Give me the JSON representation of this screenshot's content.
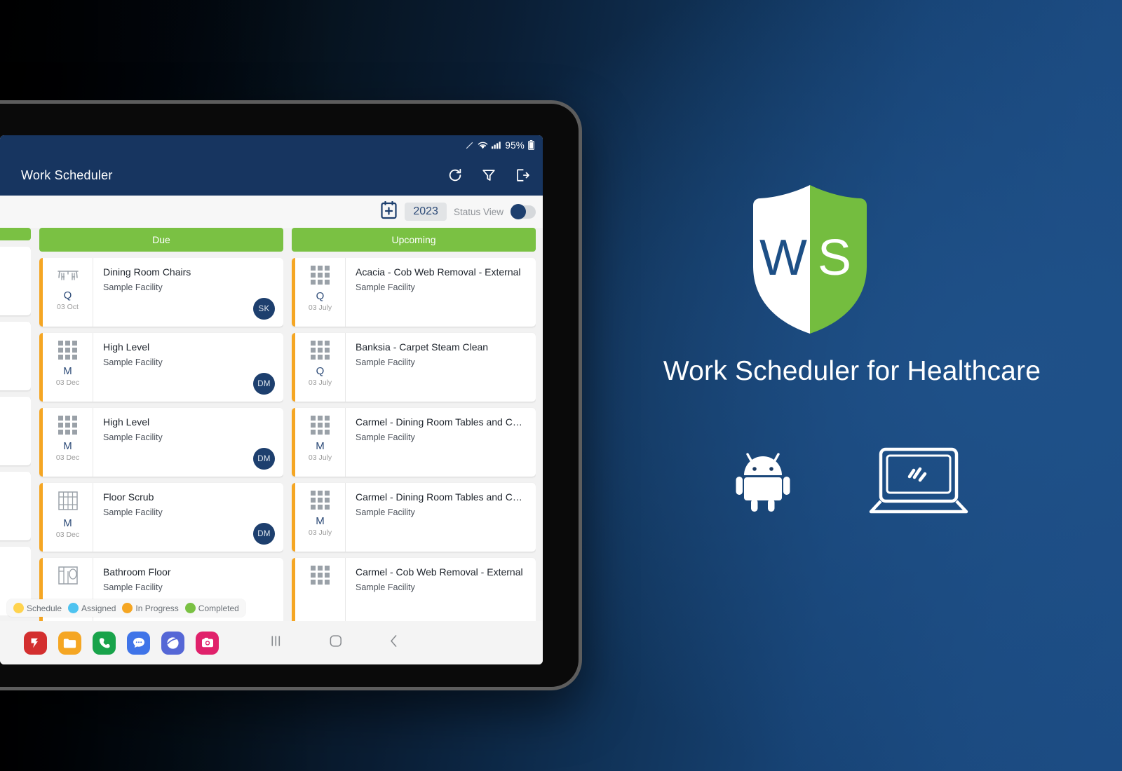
{
  "brand": {
    "title": "Work Scheduler for Healthcare",
    "logo_letters": {
      "left": "W",
      "right": "S"
    },
    "colors": {
      "navy": "#173560",
      "green": "#7ac143",
      "accent_orange": "#f5a623",
      "background_navy": "#1b4a80"
    }
  },
  "platforms": [
    {
      "name": "android-icon",
      "label": "Android"
    },
    {
      "name": "laptop-icon",
      "label": "Web / Desktop"
    }
  ],
  "device": {
    "status_bar": {
      "battery_percent": "95%",
      "icons": [
        "pen-icon",
        "wifi-icon",
        "signal-icon",
        "battery-icon"
      ]
    },
    "app_bar": {
      "title": "Work Scheduler",
      "actions": [
        {
          "name": "refresh-icon",
          "label": "Refresh"
        },
        {
          "name": "filter-icon",
          "label": "Filter"
        },
        {
          "name": "logout-icon",
          "label": "Logout"
        }
      ]
    },
    "sub_bar": {
      "add_date_icon": "calendar-plus-icon",
      "year": "2023",
      "status_view_label": "Status View",
      "status_view_on": true
    },
    "legend": [
      {
        "label": "Schedule",
        "color": "#ffd34e"
      },
      {
        "label": "Assigned",
        "color": "#4ec3f0"
      },
      {
        "label": "In Progress",
        "color": "#f5a623"
      },
      {
        "label": "Completed",
        "color": "#7ac143"
      }
    ],
    "nav_buttons": [
      {
        "name": "recents-button",
        "glyph": "|||"
      },
      {
        "name": "home-button",
        "glyph": "○"
      },
      {
        "name": "back-button",
        "glyph": "‹"
      }
    ],
    "dock_apps": [
      {
        "name": "app-icon-1",
        "color": "#d32f2f"
      },
      {
        "name": "app-icon-2",
        "color": "#f5a623"
      },
      {
        "name": "app-icon-3",
        "color": "#18a34a"
      },
      {
        "name": "app-icon-4",
        "color": "#3f74e8"
      },
      {
        "name": "app-icon-5",
        "color": "#5567d6"
      },
      {
        "name": "app-icon-6",
        "color": "#e0216b"
      }
    ]
  },
  "board": {
    "columns": [
      {
        "id": "partial",
        "header": "",
        "cards": [
          {
            "title": "",
            "facility": "",
            "frequency": "",
            "date": "",
            "initials": "",
            "icon": "blank"
          },
          {
            "title": "",
            "facility": "",
            "frequency": "",
            "date": "",
            "initials": "",
            "icon": "blank"
          },
          {
            "title": "",
            "facility": "",
            "frequency": "",
            "date": "",
            "initials": "",
            "icon": "blank"
          },
          {
            "title": "",
            "facility": "",
            "frequency": "",
            "date": "",
            "initials": "",
            "icon": "blank"
          },
          {
            "title": "",
            "facility": "",
            "frequency": "",
            "date": "",
            "initials": "",
            "icon": "blank"
          }
        ]
      },
      {
        "id": "due",
        "header": "Due",
        "cards": [
          {
            "title": "Dining Room Chairs",
            "facility": "Sample Facility",
            "frequency": "Q",
            "date": "03 Oct",
            "initials": "SK",
            "icon": "table-chairs"
          },
          {
            "title": "High Level",
            "facility": "Sample Facility",
            "frequency": "M",
            "date": "03 Dec",
            "initials": "DM",
            "icon": "grid"
          },
          {
            "title": "High Level",
            "facility": "Sample Facility",
            "frequency": "M",
            "date": "03 Dec",
            "initials": "DM",
            "icon": "grid"
          },
          {
            "title": "Floor Scrub",
            "facility": "Sample Facility",
            "frequency": "M",
            "date": "03 Dec",
            "initials": "DM",
            "icon": "floor"
          },
          {
            "title": "Bathroom Floor",
            "facility": "Sample Facility",
            "frequency": "",
            "date": "",
            "initials": "",
            "icon": "bathroom"
          }
        ]
      },
      {
        "id": "upcoming",
        "header": "Upcoming",
        "cards": [
          {
            "title": "Acacia - Cob Web Removal - External",
            "facility": "Sample Facility",
            "frequency": "Q",
            "date": "03 July",
            "initials": "",
            "icon": "grid"
          },
          {
            "title": "Banksia - Carpet Steam Clean",
            "facility": "Sample Facility",
            "frequency": "Q",
            "date": "03 July",
            "initials": "",
            "icon": "grid"
          },
          {
            "title": "Carmel - Dining Room Tables and Chairs",
            "facility": "Sample Facility",
            "frequency": "M",
            "date": "03 July",
            "initials": "",
            "icon": "grid"
          },
          {
            "title": "Carmel - Dining Room Tables and Chairs",
            "facility": "Sample Facility",
            "frequency": "M",
            "date": "03 July",
            "initials": "",
            "icon": "grid"
          },
          {
            "title": "Carmel - Cob Web Removal - External",
            "facility": "Sample Facility",
            "frequency": "",
            "date": "",
            "initials": "",
            "icon": "grid"
          }
        ]
      }
    ]
  }
}
